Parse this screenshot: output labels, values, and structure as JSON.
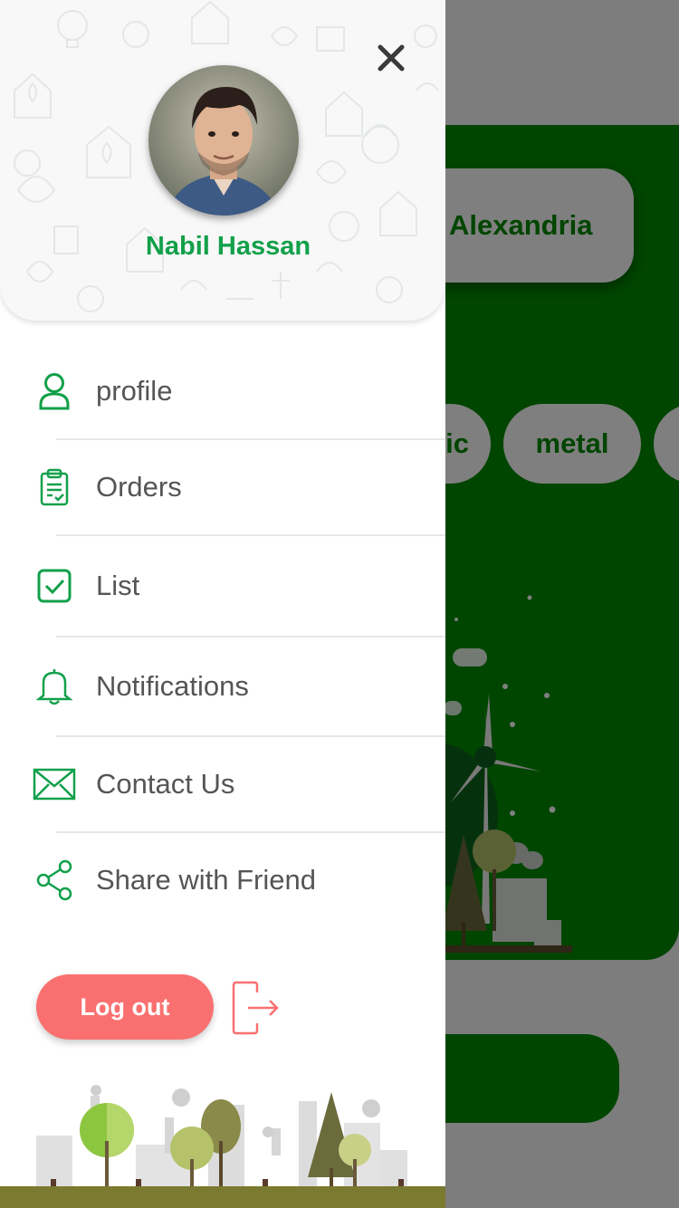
{
  "background": {
    "city_chip": "Alexandria",
    "category_chips": [
      "ic",
      "metal",
      ""
    ]
  },
  "drawer": {
    "user": {
      "name": "Nabil Hassan"
    },
    "menu": [
      {
        "label": "profile",
        "icon": "user-icon"
      },
      {
        "label": "Orders",
        "icon": "clipboard-icon"
      },
      {
        "label": "List",
        "icon": "checkbox-icon"
      },
      {
        "label": "Notifications",
        "icon": "bell-icon"
      },
      {
        "label": "Contact Us",
        "icon": "envelope-icon"
      },
      {
        "label": "Share with Friend",
        "icon": "share-icon"
      }
    ],
    "logout_label": "Log out"
  },
  "colors": {
    "accent_green": "#12a04a",
    "panel_green": "#008a00",
    "logout_red": "#fa7070",
    "text_gray": "#555555"
  }
}
